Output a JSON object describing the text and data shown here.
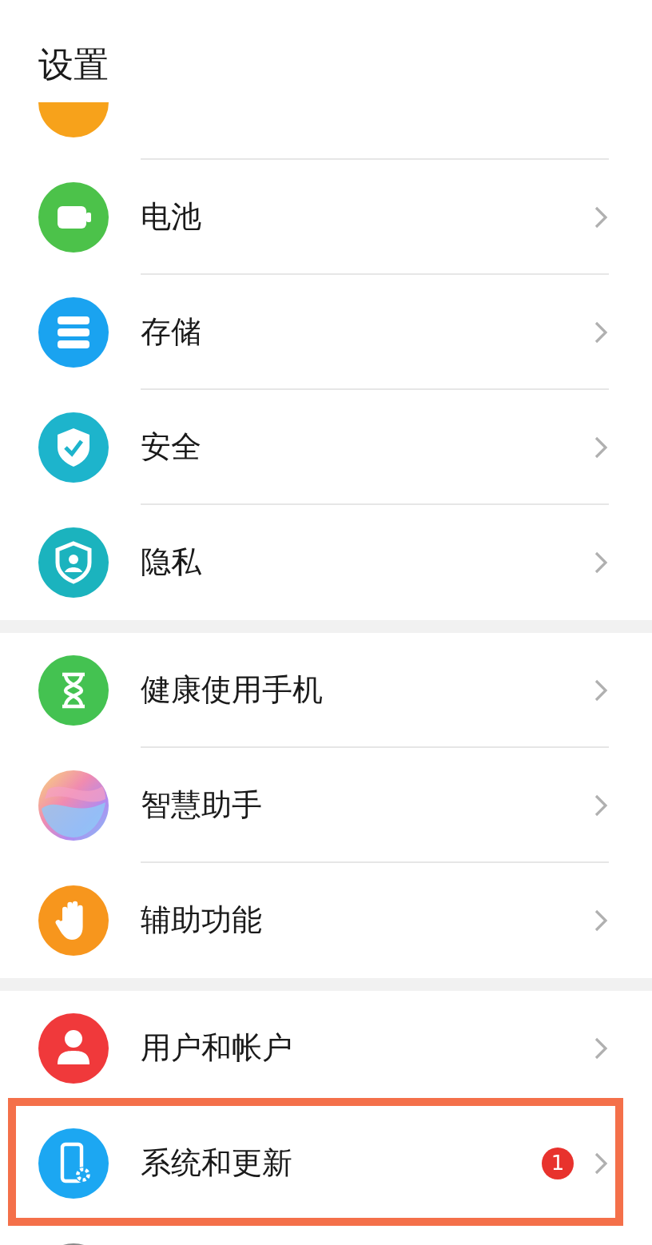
{
  "title": "设置",
  "groups": [
    {
      "items": [
        {
          "kind": "app",
          "color": "#f7a21b"
        },
        {
          "label": "电池",
          "kind": "battery",
          "color": "#4cc24a"
        },
        {
          "label": "存储",
          "kind": "storage",
          "color": "#1aa3f0"
        },
        {
          "label": "安全",
          "kind": "shield",
          "color": "#1db4cc"
        },
        {
          "label": "隐私",
          "kind": "privacy",
          "color": "#1bb3be"
        }
      ]
    },
    {
      "items": [
        {
          "label": "健康使用手机",
          "kind": "hourglass",
          "color": "#44c251"
        },
        {
          "label": "智慧助手",
          "kind": "orb"
        },
        {
          "label": "辅助功能",
          "kind": "hand",
          "color": "#f7961d"
        }
      ]
    },
    {
      "items": [
        {
          "label": "用户和帐户",
          "kind": "user",
          "color": "#f0393b"
        },
        {
          "label": "系统和更新",
          "kind": "phonegear",
          "color": "#1ca7f2",
          "badge": "1",
          "highlighted": true
        },
        {
          "kind": "generic",
          "color": "#8a8a8a"
        }
      ]
    }
  ]
}
